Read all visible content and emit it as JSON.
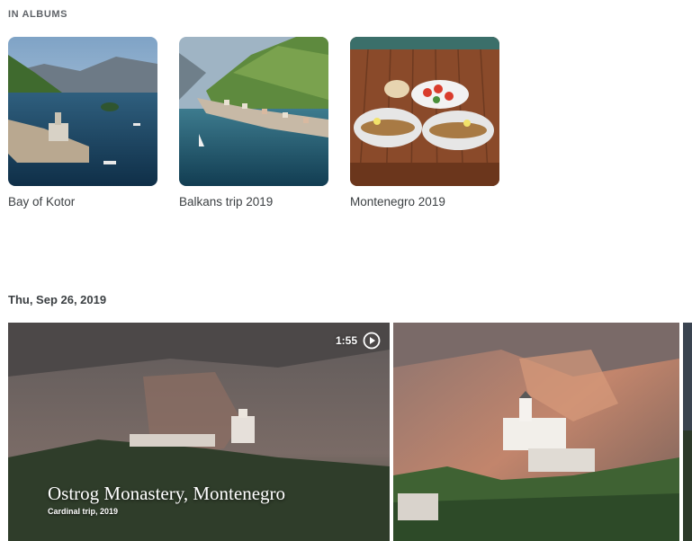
{
  "albums_section": {
    "label": "IN ALBUMS",
    "albums": [
      {
        "title": "Bay of Kotor"
      },
      {
        "title": "Balkans trip 2019"
      },
      {
        "title": "Montenegro 2019"
      }
    ]
  },
  "photos_section": {
    "date": "Thu, Sep 26, 2019",
    "video": {
      "duration": "1:55",
      "title": "Ostrog Monastery, Montenegro",
      "subtitle": "Cardinal trip, 2019"
    }
  },
  "colors": {
    "text": "#3c4043",
    "label": "#5f6368",
    "background": "#ffffff"
  },
  "icons": {
    "play": "play-circle-icon"
  }
}
